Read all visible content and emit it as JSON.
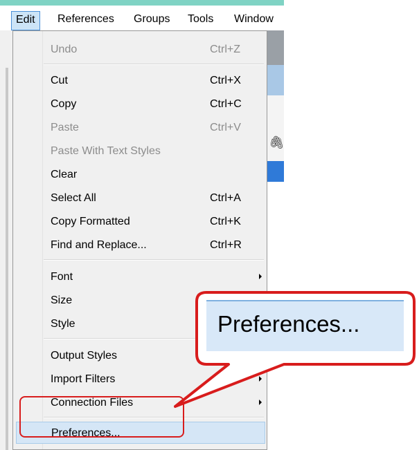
{
  "menubar": {
    "items": [
      "Edit",
      "References",
      "Groups",
      "Tools",
      "Window"
    ]
  },
  "menu": {
    "items": [
      {
        "label": "Undo",
        "shortcut": "Ctrl+Z"
      },
      {
        "label": "Cut",
        "shortcut": "Ctrl+X"
      },
      {
        "label": "Copy",
        "shortcut": "Ctrl+C"
      },
      {
        "label": "Paste",
        "shortcut": "Ctrl+V"
      },
      {
        "label": "Paste With Text Styles",
        "shortcut": ""
      },
      {
        "label": "Clear",
        "shortcut": ""
      },
      {
        "label": "Select All",
        "shortcut": "Ctrl+A"
      },
      {
        "label": "Copy Formatted",
        "shortcut": "Ctrl+K"
      },
      {
        "label": "Find and Replace...",
        "shortcut": "Ctrl+R"
      },
      {
        "label": "Font",
        "shortcut": ""
      },
      {
        "label": "Size",
        "shortcut": ""
      },
      {
        "label": "Style",
        "shortcut": ""
      },
      {
        "label": "Output Styles",
        "shortcut": ""
      },
      {
        "label": "Import Filters",
        "shortcut": ""
      },
      {
        "label": "Connection Files",
        "shortcut": ""
      },
      {
        "label": "Preferences...",
        "shortcut": ""
      }
    ]
  },
  "callout": {
    "text": "Preferences..."
  },
  "colors": {
    "highlight_red": "#d81c1c",
    "hover_blue": "#d5e6f6",
    "menubar_accent": "#7fd3c4"
  }
}
